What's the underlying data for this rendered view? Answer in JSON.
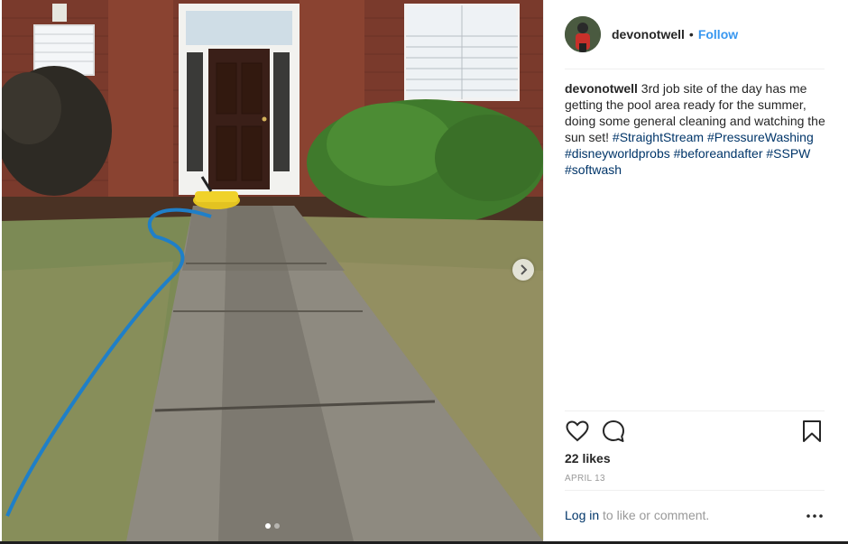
{
  "post": {
    "username": "devonotwell",
    "separator": "•",
    "follow_label": "Follow",
    "caption": {
      "username": "devonotwell",
      "text": "3rd job site of the day has me getting the pool area ready for the summer, doing some general cleaning and watching the sun set!",
      "hashtags": [
        "#StraightStream",
        "#PressureWashing",
        "#disneyworldprobs",
        "#beforeandafter",
        "#SSPW",
        "#softwash"
      ]
    },
    "actions": {
      "like_icon": "heart-outline-icon",
      "comment_icon": "comment-bubble-icon",
      "save_icon": "bookmark-icon"
    },
    "likes_text": "22 likes",
    "date_text": "April 13",
    "footer": {
      "login_label": "Log in",
      "login_suffix": " to like or comment.",
      "more_icon": "more-options-icon"
    },
    "carousel": {
      "next_icon": "chevron-right-icon",
      "slide_count": 2,
      "active_slide": 1
    }
  },
  "colors": {
    "link": "#003569",
    "follow": "#3897f0",
    "muted": "#999999",
    "text": "#262626"
  }
}
